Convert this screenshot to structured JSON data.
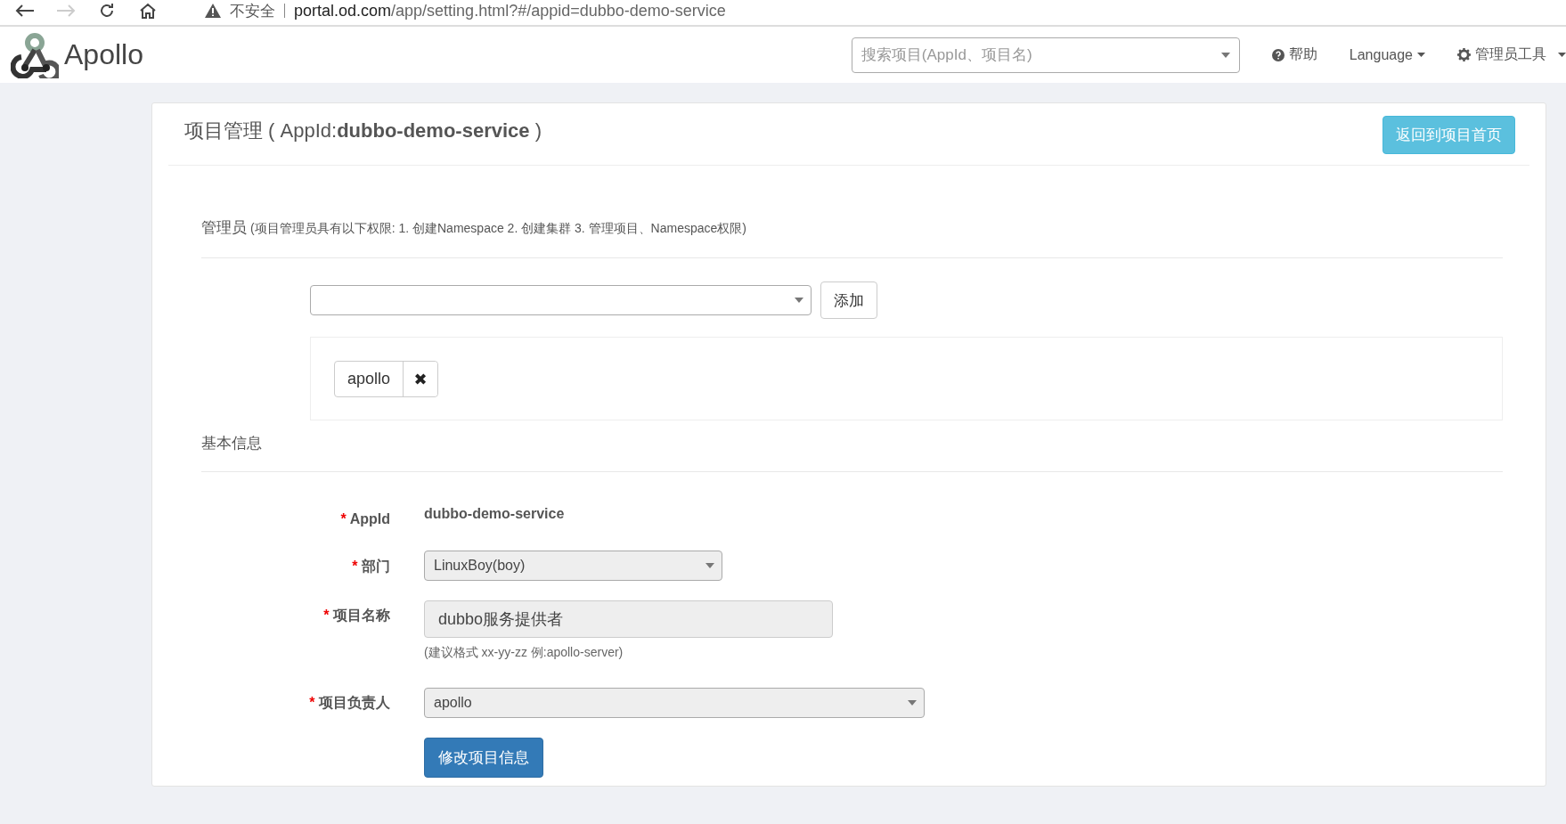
{
  "browser": {
    "nav_buttons": [
      {
        "kind": "back",
        "disabled": false
      },
      {
        "kind": "forward",
        "disabled": true
      },
      {
        "kind": "reload",
        "disabled": false
      },
      {
        "kind": "home",
        "disabled": false
      }
    ],
    "security_label": "不安全",
    "url_host": "portal.od.com",
    "url_path": "/app/setting.html?#/appid=dubbo-demo-service"
  },
  "navbar": {
    "brand": "Apollo",
    "search": {
      "placeholder": "搜索项目(AppId、项目名)"
    },
    "help": "帮助",
    "language": "Language",
    "admin_tools": "管理员工具"
  },
  "page": {
    "title": "项目管理 ( AppId:**dubbo-demo-service** )",
    "back_button": "返回到项目首页"
  },
  "admins": {
    "heading": "管理员",
    "note": "(项目管理员具有以下权限: 1. 创建Namespace 2. 创建集群 3. 管理项目、Namespace权限)",
    "add_button": "添加",
    "members": [
      {
        "name": "apollo",
        "remove": "✖"
      }
    ]
  },
  "basic_info": {
    "heading": "基本信息",
    "fields": [
      {
        "kind": "text",
        "mark": "*",
        "label": "AppId",
        "value": "dubbo-demo-service"
      },
      {
        "kind": "select",
        "mark": "*",
        "label": "部门",
        "value": "LinuxBoy(boy)"
      },
      {
        "kind": "input",
        "mark": "*",
        "label": "项目名称",
        "value": "dubbo服务提供者",
        "hint": "(建议格式 xx-yy-zz 例:apollo-server)"
      },
      {
        "kind": "select",
        "mark": "*",
        "label": "项目负责人",
        "value": "apollo"
      }
    ],
    "submit_button": "修改项目信息"
  }
}
